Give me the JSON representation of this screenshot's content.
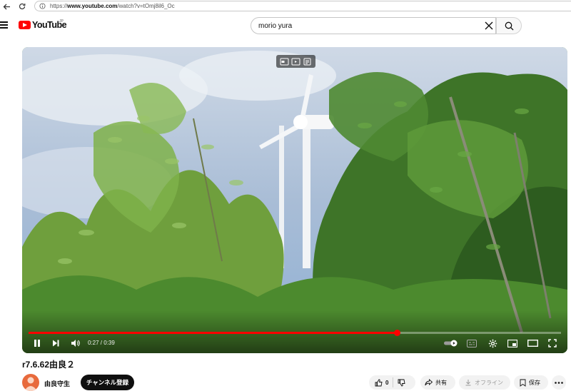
{
  "browser": {
    "url_prefix": "https://",
    "url_domain": "www.youtube.com",
    "url_path": "/watch?v=tOmj8il6_Oc"
  },
  "header": {
    "logo_text": "YouTube",
    "logo_region": "JP",
    "search_value": "morio yura"
  },
  "player": {
    "current_time": "0:27",
    "duration": "0:39",
    "progress_fraction": 0.692
  },
  "video": {
    "title": "r7.6.62由良２"
  },
  "channel": {
    "name": "由良守生",
    "subscribe_label": "チャンネル登録"
  },
  "actions": {
    "like_count": "0",
    "share_label": "共有",
    "offline_label": "オフライン",
    "save_label": "保存"
  },
  "colors": {
    "accent": "#ff0000",
    "button_dark": "#0f0f0f",
    "pill_bg": "#f2f2f2"
  }
}
